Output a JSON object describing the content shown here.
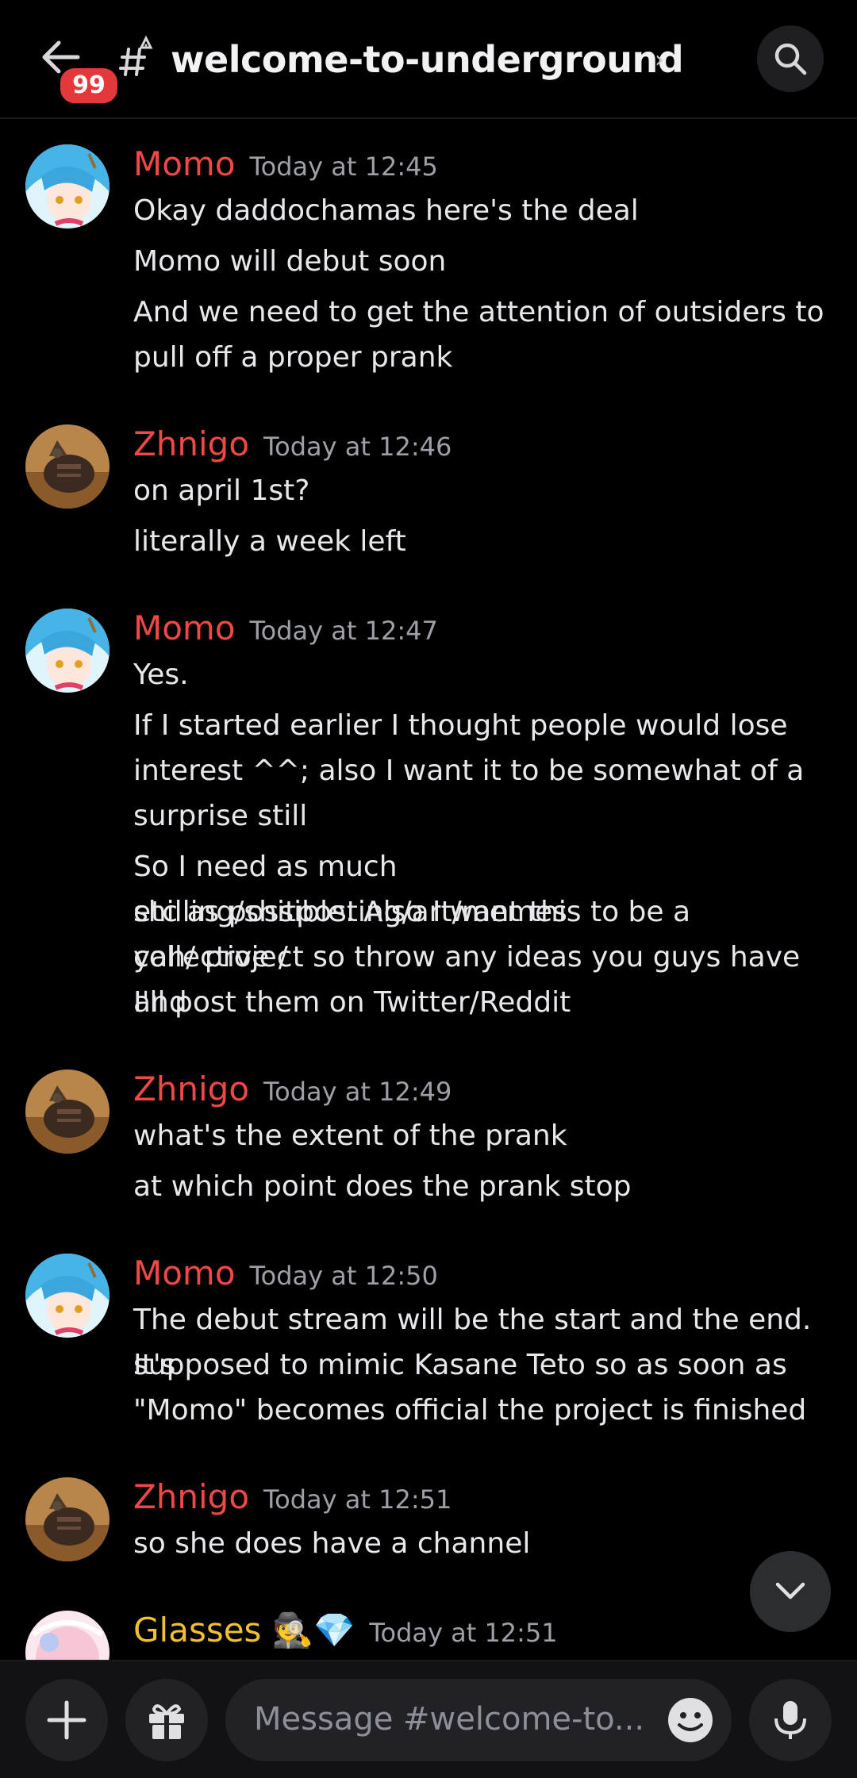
{
  "header": {
    "badge_count": "99",
    "channel_name": "welcome-to-underground",
    "chevron": "›"
  },
  "messages": [
    {
      "author": "Momo",
      "time": "Today at 12:45",
      "author_color": "#f04747",
      "lines": [
        "Okay daddochamas here's the deal",
        "Momo will debut soon",
        "And we need to get the attention of outsiders to",
        "pull off a proper prank"
      ]
    },
    {
      "author": "Zhnigo",
      "time": "Today at 12:46",
      "author_color": "#f04747",
      "lines": [
        "on april 1st?",
        "literally a week left"
      ]
    },
    {
      "author": "Momo",
      "time": "Today at 12:47",
      "author_color": "#f04747",
      "lines": [
        "Yes.",
        "If I started earlier I thought people would lose",
        "interest ^^; also I want it to be somewhat of a",
        "surprise still",
        "So I need as much shilling/shitposting/art/memes",
        "etc as possible. Also I want this to be a collective /",
        "yah/ project so throw any ideas you guys have and",
        "I'll post them on Twitter/Reddit"
      ]
    },
    {
      "author": "Zhnigo",
      "time": "Today at 12:49",
      "author_color": "#f04747",
      "lines": [
        "what's the extent of the prank",
        "at which point does the prank stop"
      ]
    },
    {
      "author": "Momo",
      "time": "Today at 12:50",
      "author_color": "#f04747",
      "lines": [
        "The debut stream will be the start and the end. It's",
        "supposed to mimic Kasane Teto so as soon as",
        "\"Momo\" becomes official the project is finished"
      ]
    },
    {
      "author": "Zhnigo",
      "time": "Today at 12:51",
      "author_color": "#f04747",
      "lines": [
        "so she does have a channel"
      ]
    },
    {
      "author": "Glasses 🕵️💎",
      "time": "Today at 12:51",
      "author_color": "#f0c030",
      "lines": []
    }
  ],
  "composer": {
    "placeholder": "Message #welcome-to..."
  },
  "icons": {
    "back": "back-arrow-icon",
    "channel": "hash-rules-icon",
    "search": "search-icon",
    "scroll": "chevron-down-icon",
    "add": "plus-icon",
    "gift": "gift-icon",
    "emoji": "emoji-icon",
    "mic": "microphone-icon"
  }
}
